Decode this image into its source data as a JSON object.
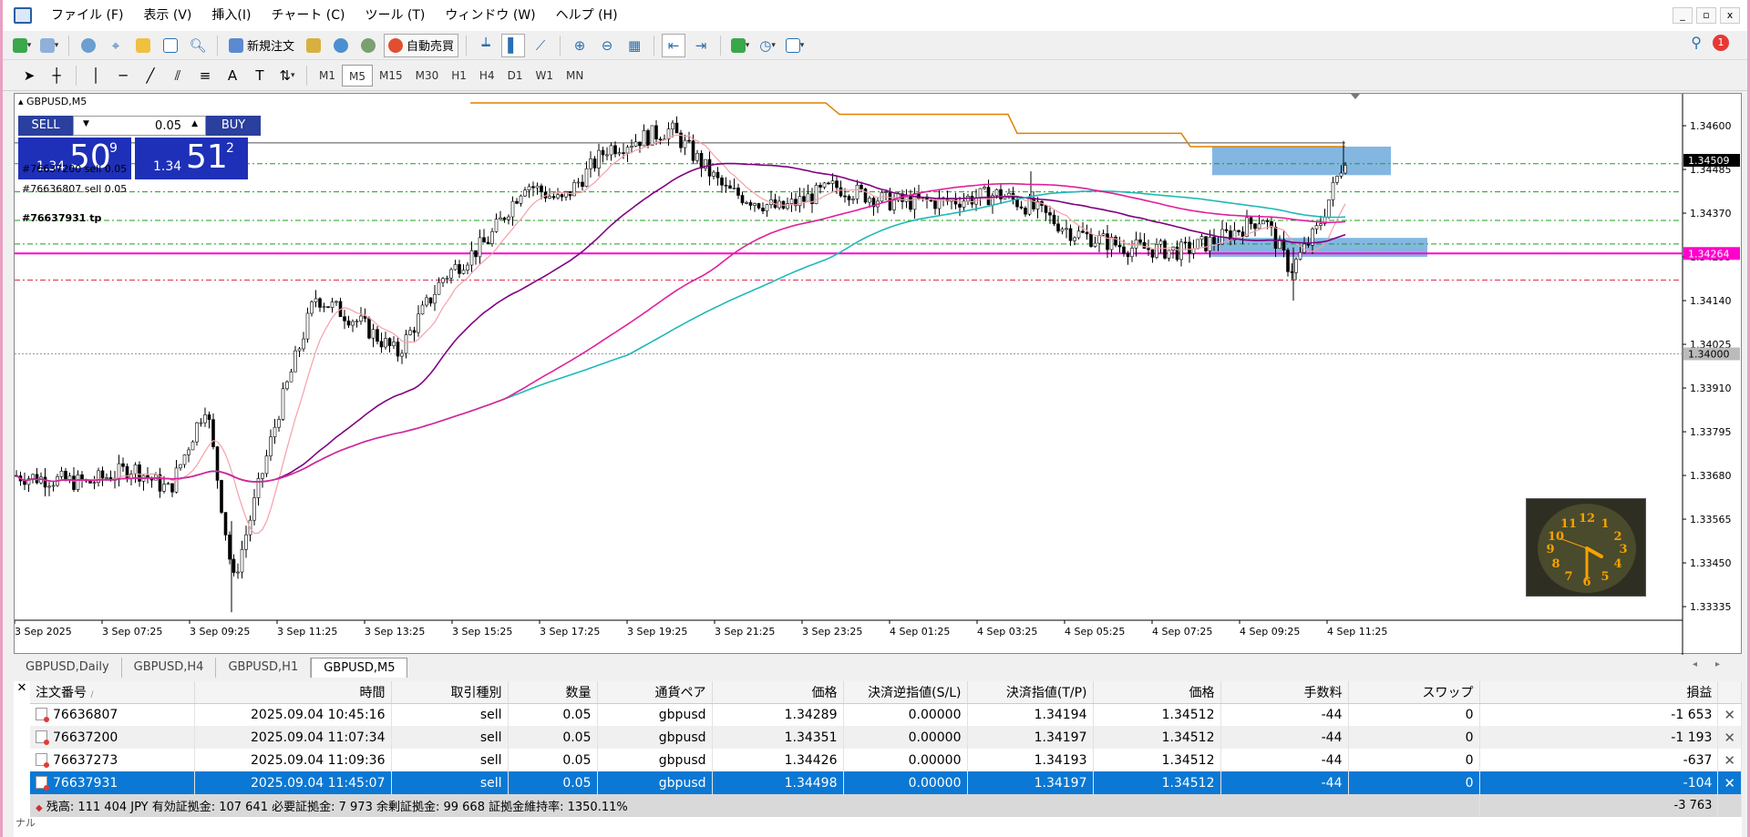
{
  "menubar": {
    "items": [
      "ファイル (F)",
      "表示 (V)",
      "挿入(I)",
      "チャート (C)",
      "ツール (T)",
      "ウィンドウ (W)",
      "ヘルプ (H)"
    ],
    "window_controls": [
      "_",
      "▫",
      "x"
    ]
  },
  "toolbar1": {
    "new_order_label": "新規注文",
    "auto_trade_label": "自動売買",
    "notification_count": "1"
  },
  "toolbar2": {
    "timeframes": [
      "M1",
      "M5",
      "M15",
      "M30",
      "H1",
      "H4",
      "D1",
      "W1",
      "MN"
    ],
    "active_timeframe": "M5"
  },
  "chart": {
    "symbol_label": "GBPUSD,M5",
    "trade_panel": {
      "sell_label": "SELL",
      "buy_label": "BUY",
      "lot": "0.05",
      "sell_price_small": "1.34",
      "sell_price_big": "50",
      "sell_price_sup": "9",
      "buy_price_small": "1.34",
      "buy_price_big": "51",
      "buy_price_sup": "2"
    },
    "order_labels": {
      "label1": "#76637200 sell 0.05",
      "label2": "#76636807 sell 0.05",
      "label3": "#76637931 tp"
    },
    "price_axis": [
      "1.34600",
      "1.34485",
      "1.34370",
      "1.34255",
      "1.34140",
      "1.34025",
      "1.33910",
      "1.33795",
      "1.33680",
      "1.33565",
      "1.33450",
      "1.33335"
    ],
    "price_markers": {
      "bid": "1.34509",
      "line": "1.34264",
      "level": "1.34000"
    },
    "time_axis": [
      "3 Sep 2025",
      "3 Sep 07:25",
      "3 Sep 09:25",
      "3 Sep 11:25",
      "3 Sep 13:25",
      "3 Sep 15:25",
      "3 Sep 17:25",
      "3 Sep 19:25",
      "3 Sep 21:25",
      "3 Sep 23:25",
      "4 Sep 01:25",
      "4 Sep 03:25",
      "4 Sep 05:25",
      "4 Sep 07:25",
      "4 Sep 09:25",
      "4 Sep 11:25"
    ],
    "colors": {
      "bull_candle": "#000000",
      "ma_fast": "#f4a0a8",
      "ma_mid": "#800080",
      "ma_slow_magenta": "#e0209a",
      "ma_slow_cyan": "#20b8b8",
      "resistance_line": "#e08000",
      "tp_line": "#ff00cc",
      "zone_fill": "#5a9fd8"
    }
  },
  "chart_tabs": [
    "GBPUSD,Daily",
    "GBPUSD,H4",
    "GBPUSD,H1",
    "GBPUSD,M5"
  ],
  "active_tab": "GBPUSD,M5",
  "terminal": {
    "headers": [
      "注文番号",
      "時間",
      "取引種別",
      "数量",
      "通貨ペア",
      "価格",
      "決済逆指値(S/L)",
      "決済指値(T/P)",
      "価格",
      "手数料",
      "スワップ",
      "損益"
    ],
    "rows": [
      [
        "76636807",
        "2025.09.04 10:45:16",
        "sell",
        "0.05",
        "gbpusd",
        "1.34289",
        "0.00000",
        "1.34194",
        "1.34512",
        "-44",
        "0",
        "-1 653"
      ],
      [
        "76637200",
        "2025.09.04 11:07:34",
        "sell",
        "0.05",
        "gbpusd",
        "1.34351",
        "0.00000",
        "1.34197",
        "1.34512",
        "-44",
        "0",
        "-1 193"
      ],
      [
        "76637273",
        "2025.09.04 11:09:36",
        "sell",
        "0.05",
        "gbpusd",
        "1.34426",
        "0.00000",
        "1.34193",
        "1.34512",
        "-44",
        "0",
        "-637"
      ],
      [
        "76637931",
        "2025.09.04 11:45:07",
        "sell",
        "0.05",
        "gbpusd",
        "1.34498",
        "0.00000",
        "1.34197",
        "1.34512",
        "-44",
        "0",
        "-104"
      ]
    ],
    "summary": {
      "text": "残高: 111 404 JPY  有効証拠金: 107 641  必要証拠金: 7 973  余剰証拠金: 99 668  証拠金維持率: 1350.11%",
      "total": "-3 763"
    },
    "side_label": "ナル"
  }
}
